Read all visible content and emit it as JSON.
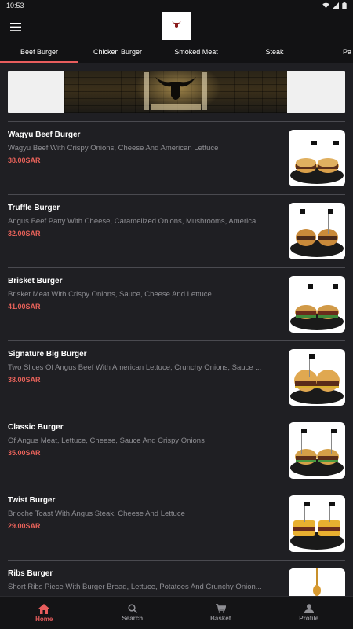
{
  "status_bar": {
    "time": "10:53"
  },
  "tabs": [
    {
      "label": "Beef Burger",
      "active": true
    },
    {
      "label": "Chicken Burger",
      "active": false
    },
    {
      "label": "Smoked Meat",
      "active": false
    },
    {
      "label": "Steak",
      "active": false
    },
    {
      "label": "Pa",
      "active": false
    }
  ],
  "items": [
    {
      "name": "Wagyu Beef Burger",
      "description": "Wagyu Beef With Crispy Onions, Cheese And American Lettuce",
      "price": "38.00SAR"
    },
    {
      "name": "Truffle Burger",
      "description": "Angus Beef Patty With Cheese, Caramelized Onions, Mushrooms, America...",
      "price": "32.00SAR"
    },
    {
      "name": "Brisket Burger",
      "description": "Brisket Meat With Crispy Onions, Sauce, Cheese And Lettuce",
      "price": "41.00SAR"
    },
    {
      "name": "Signature Big Burger",
      "description": "Two Slices Of Angus Beef With American Lettuce, Crunchy Onions, Sauce ...",
      "price": "38.00SAR"
    },
    {
      "name": "Classic Burger",
      "description": "Of Angus Meat, Lettuce, Cheese, Sauce And Crispy Onions",
      "price": "35.00SAR"
    },
    {
      "name": "Twist Burger",
      "description": "Brioche Toast With Angus Steak, Cheese And Lettuce",
      "price": "29.00SAR"
    },
    {
      "name": "Ribs Burger",
      "description": "Short Ribs Piece With Burger Bread, Lettuce, Potatoes And Crunchy Onion...",
      "price": ""
    }
  ],
  "bottom_nav": [
    {
      "label": "Home",
      "icon": "home-icon",
      "active": true
    },
    {
      "label": "Search",
      "icon": "search-icon",
      "active": false
    },
    {
      "label": "Basket",
      "icon": "basket-icon",
      "active": false
    },
    {
      "label": "Profile",
      "icon": "profile-icon",
      "active": false
    }
  ],
  "colors": {
    "accent": "#e85d5d",
    "price": "#e8625a",
    "background": "#1f1f23",
    "muted": "#8e8e93"
  }
}
